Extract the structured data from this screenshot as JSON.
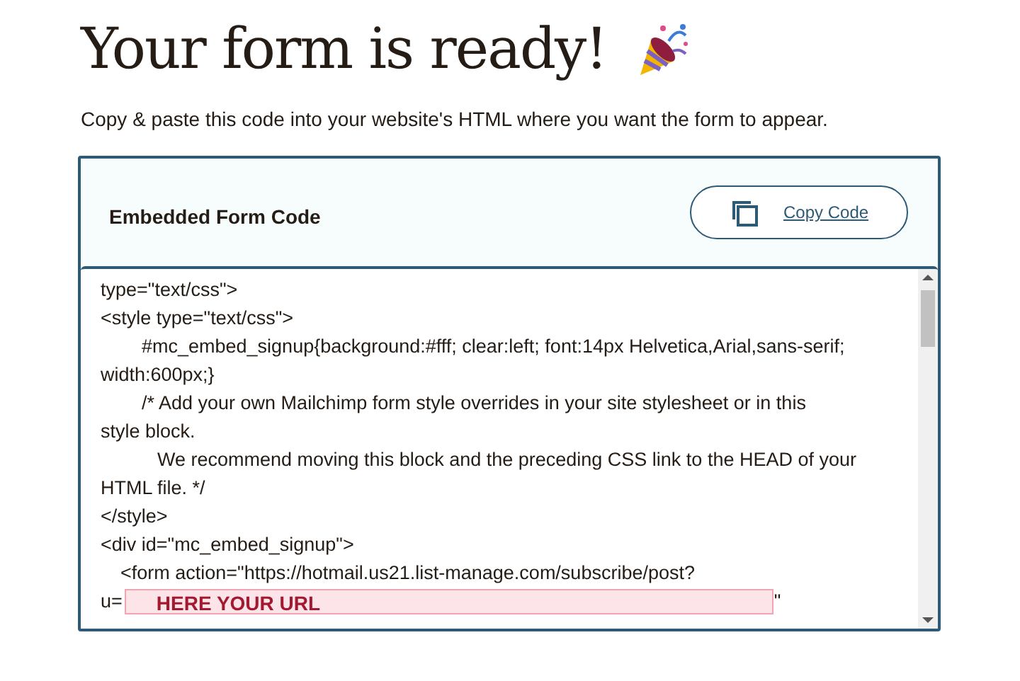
{
  "heading": "Your form is ready!",
  "subtitle": "Copy & paste this code into your website's HTML where you want the form to appear.",
  "card": {
    "title": "Embedded Form Code",
    "copy_button": "Copy Code"
  },
  "code_lines": [
    {
      "kind": "plain",
      "text": "type=\"text/css\">"
    },
    {
      "kind": "plain",
      "text": "<style type=\"text/css\">"
    },
    {
      "kind": "indent",
      "text": "#mc_embed_signup{background:#fff; clear:left; font:14px Helvetica,Arial,sans-serif;"
    },
    {
      "kind": "plain",
      "text": "width:600px;}"
    },
    {
      "kind": "indent",
      "text": "/* Add your own Mailchimp form style overrides in your site stylesheet or in this"
    },
    {
      "kind": "plain",
      "text": "style block."
    },
    {
      "kind": "deep",
      "text": "We recommend moving this block and the preceding CSS link to the HEAD of your"
    },
    {
      "kind": "plain",
      "text": "HTML file. */"
    },
    {
      "kind": "plain",
      "text": "</style>"
    },
    {
      "kind": "plain",
      "text": "<div id=\"mc_embed_signup\">"
    },
    {
      "kind": "small",
      "text": "<form action=\"https://hotmail.us21.list-manage.com/subscribe/post?"
    },
    {
      "kind": "url",
      "prefix": "u=",
      "label": "HERE YOUR URL",
      "suffix": "\""
    }
  ]
}
